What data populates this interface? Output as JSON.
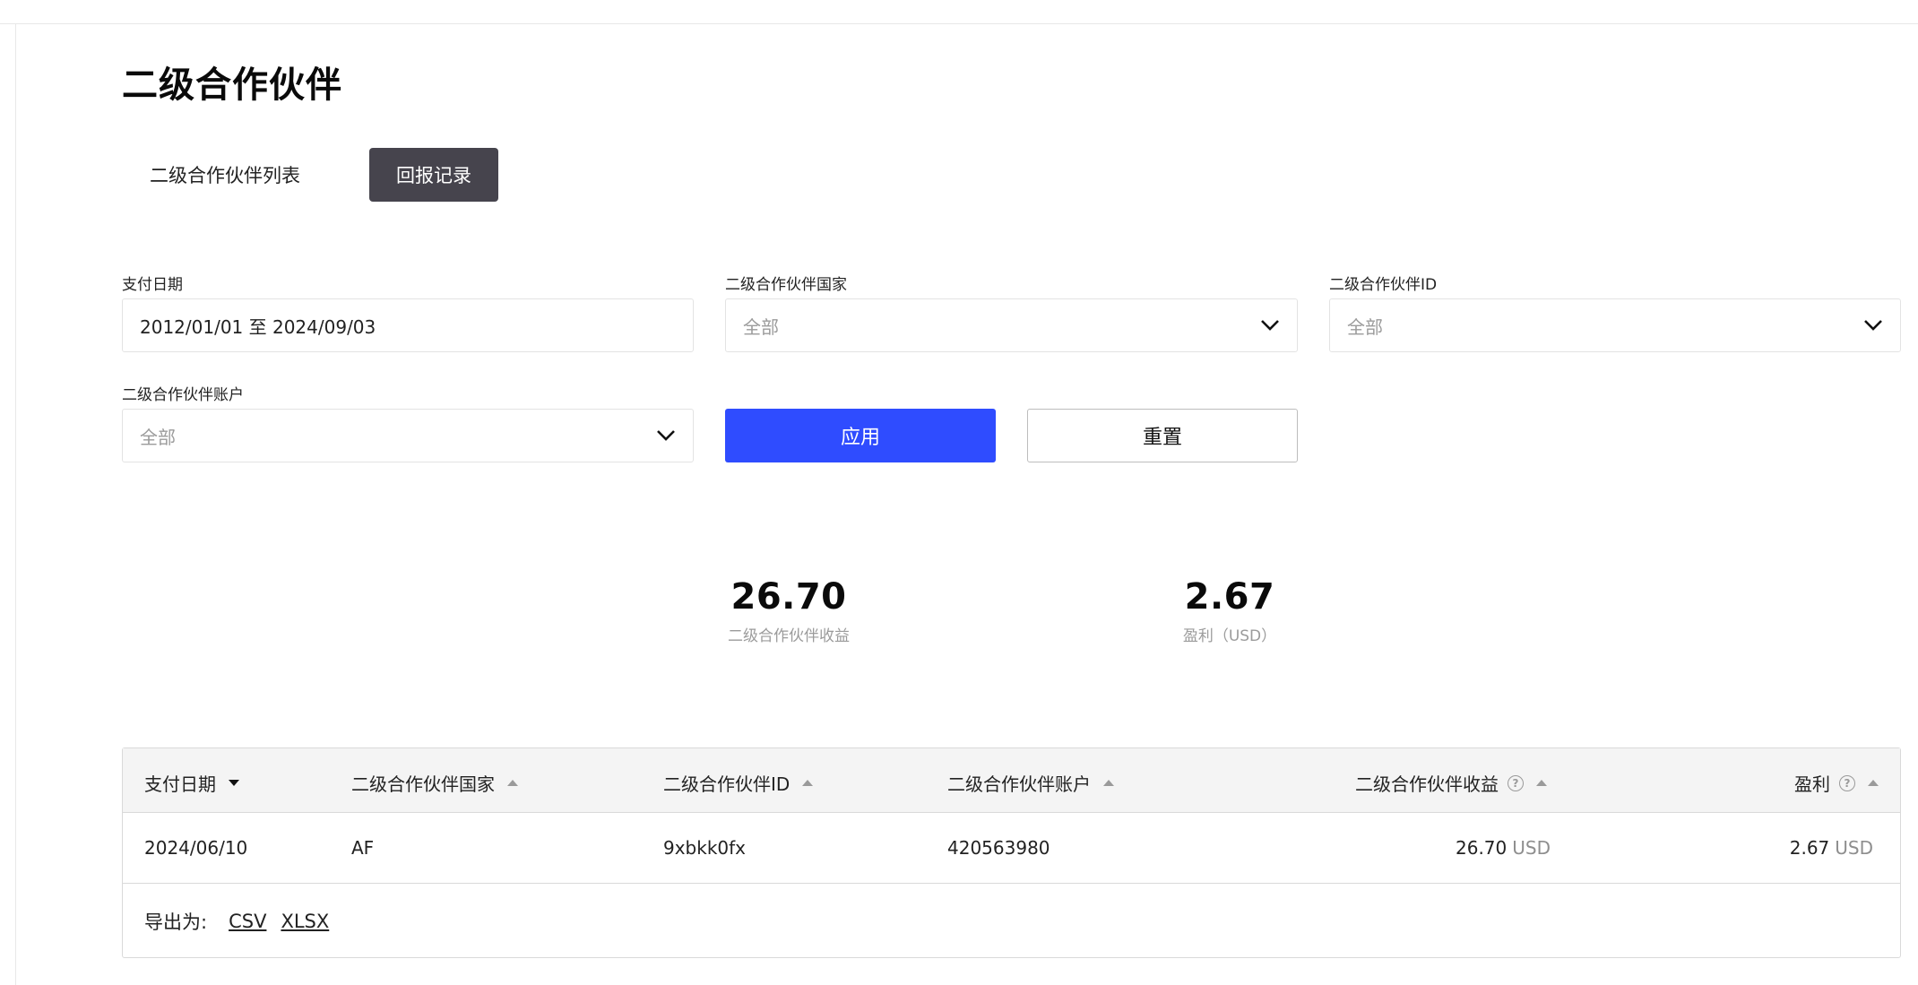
{
  "page": {
    "title": "二级合作伙伴"
  },
  "tabs": [
    {
      "label": "二级合作伙伴列表",
      "active": false
    },
    {
      "label": "回报记录",
      "active": true
    }
  ],
  "filters": {
    "payment_date": {
      "label": "支付日期",
      "value": "2012/01/01 至 2024/09/03"
    },
    "country": {
      "label": "二级合作伙伴国家",
      "placeholder": "全部"
    },
    "partner_id": {
      "label": "二级合作伙伴ID",
      "placeholder": "全部"
    },
    "account": {
      "label": "二级合作伙伴账户",
      "placeholder": "全部"
    },
    "apply_label": "应用",
    "reset_label": "重置"
  },
  "summary": [
    {
      "value": "26.70",
      "caption": "二级合作伙伴收益"
    },
    {
      "value": "2.67",
      "caption": "盈利（USD）"
    }
  ],
  "table": {
    "columns": [
      "支付日期",
      "二级合作伙伴国家",
      "二级合作伙伴ID",
      "二级合作伙伴账户",
      "二级合作伙伴收益",
      "盈利"
    ],
    "rows": [
      {
        "date": "2024/06/10",
        "country": "AF",
        "id": "9xbkk0fx",
        "account": "420563980",
        "earnings": "26.70",
        "earnings_unit": "USD",
        "profit": "2.67",
        "profit_unit": "USD"
      }
    ],
    "export": {
      "label": "导出为:",
      "csv": "CSV",
      "xlsx": "XLSX"
    }
  },
  "colors": {
    "accent": "#2f4cff",
    "active_tab": "#46444d"
  },
  "icons": {
    "dropdown": "chevron-down-icon",
    "help": "help-circle-icon",
    "sort": "sort-caret-icon"
  }
}
